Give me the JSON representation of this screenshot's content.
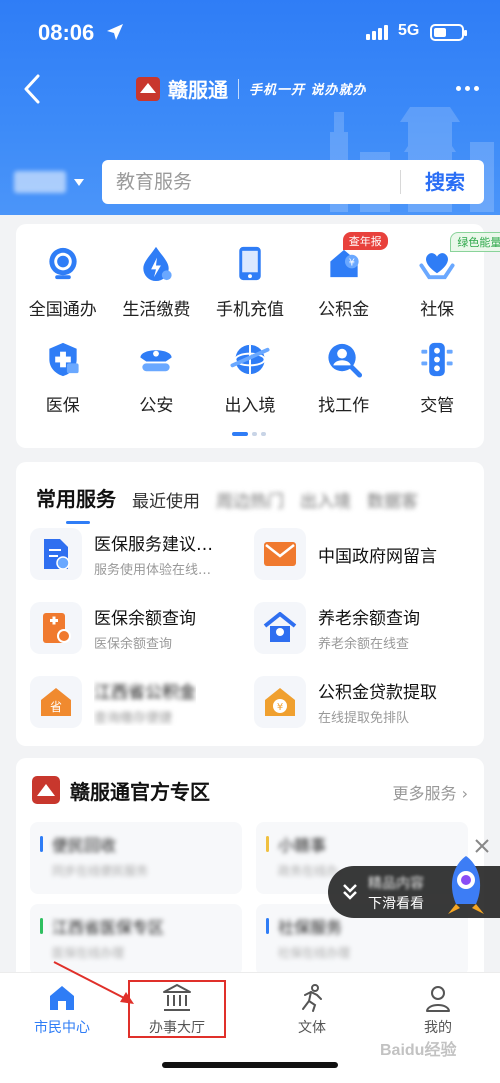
{
  "status_bar": {
    "time": "08:06",
    "network": "5G"
  },
  "header": {
    "brand_name": "赣服通",
    "slogan": "手机一开 说办就办"
  },
  "search": {
    "placeholder": "教育服务",
    "button_label": "搜索"
  },
  "services": [
    {
      "label": "全国通办",
      "icon": "globe-service-icon"
    },
    {
      "label": "生活缴费",
      "icon": "utility-payment-icon"
    },
    {
      "label": "手机充值",
      "icon": "phone-topup-icon"
    },
    {
      "label": "公积金",
      "icon": "housing-fund-icon",
      "badge": "查年报"
    },
    {
      "label": "社保",
      "icon": "social-security-icon",
      "badge": "绿色能量"
    },
    {
      "label": "医保",
      "icon": "medical-insurance-icon"
    },
    {
      "label": "公安",
      "icon": "police-icon"
    },
    {
      "label": "出入境",
      "icon": "immigration-icon"
    },
    {
      "label": "找工作",
      "icon": "job-search-icon"
    },
    {
      "label": "交管",
      "icon": "traffic-icon"
    }
  ],
  "common": {
    "tabs": [
      {
        "label": "常用服务",
        "active": true
      },
      {
        "label": "最近使用"
      },
      {
        "label": "周边热门",
        "blurred": true
      },
      {
        "label": "出入境",
        "blurred": true
      },
      {
        "label": "数据客",
        "blurred": true
      }
    ],
    "items": [
      {
        "title": "医保服务建议…",
        "subtitle": "服务使用体验在线…",
        "icon": "document-edit-icon",
        "color": "#2f6ff0"
      },
      {
        "title": "中国政府网留言",
        "subtitle": "",
        "icon": "mail-icon",
        "color": "#f07a2f"
      },
      {
        "title": "医保余额查询",
        "subtitle": "医保余额查询",
        "icon": "balance-card-icon",
        "color": "#f07a2f"
      },
      {
        "title": "养老余额查询",
        "subtitle": "养老余额在线查",
        "icon": "pension-home-icon",
        "color": "#2f6ff0"
      },
      {
        "title": "江西省公积金",
        "subtitle": "查询缴存便捷",
        "icon": "province-home-icon",
        "color": "#f08a2f",
        "blurred": true
      },
      {
        "title": "公积金贷款提取",
        "subtitle": "在线提取免排队",
        "icon": "loan-home-icon",
        "color": "#f0a02f"
      }
    ]
  },
  "zone": {
    "title": "赣服通官方专区",
    "more_label": "更多服务",
    "items": [
      {
        "title": "便民回收",
        "subtitle": "同步在线便民服务",
        "bar_color": "#2f7df6"
      },
      {
        "title": "小赣事",
        "subtitle": "政务在线办",
        "bar_color": "#f0c040"
      },
      {
        "title": "江西省医保专区",
        "subtitle": "医保在线办理",
        "bar_color": "#2fbf60"
      },
      {
        "title": "社保服务",
        "subtitle": "社保在线办理",
        "bar_color": "#2f7df6"
      }
    ]
  },
  "float_promo": {
    "line1": "精品内容",
    "line2": "下滑看看"
  },
  "tabbar": [
    {
      "label": "市民中心",
      "icon": "home-icon",
      "active": true
    },
    {
      "label": "办事大厅",
      "icon": "government-hall-icon"
    },
    {
      "label": "文体",
      "icon": "sports-figure-icon"
    },
    {
      "label": "我的",
      "icon": "profile-icon"
    }
  ],
  "watermark": "Baidu经验",
  "colors": {
    "primary": "#2f7df6",
    "brand_red": "#c8372d",
    "highlight": "#e0302a"
  }
}
